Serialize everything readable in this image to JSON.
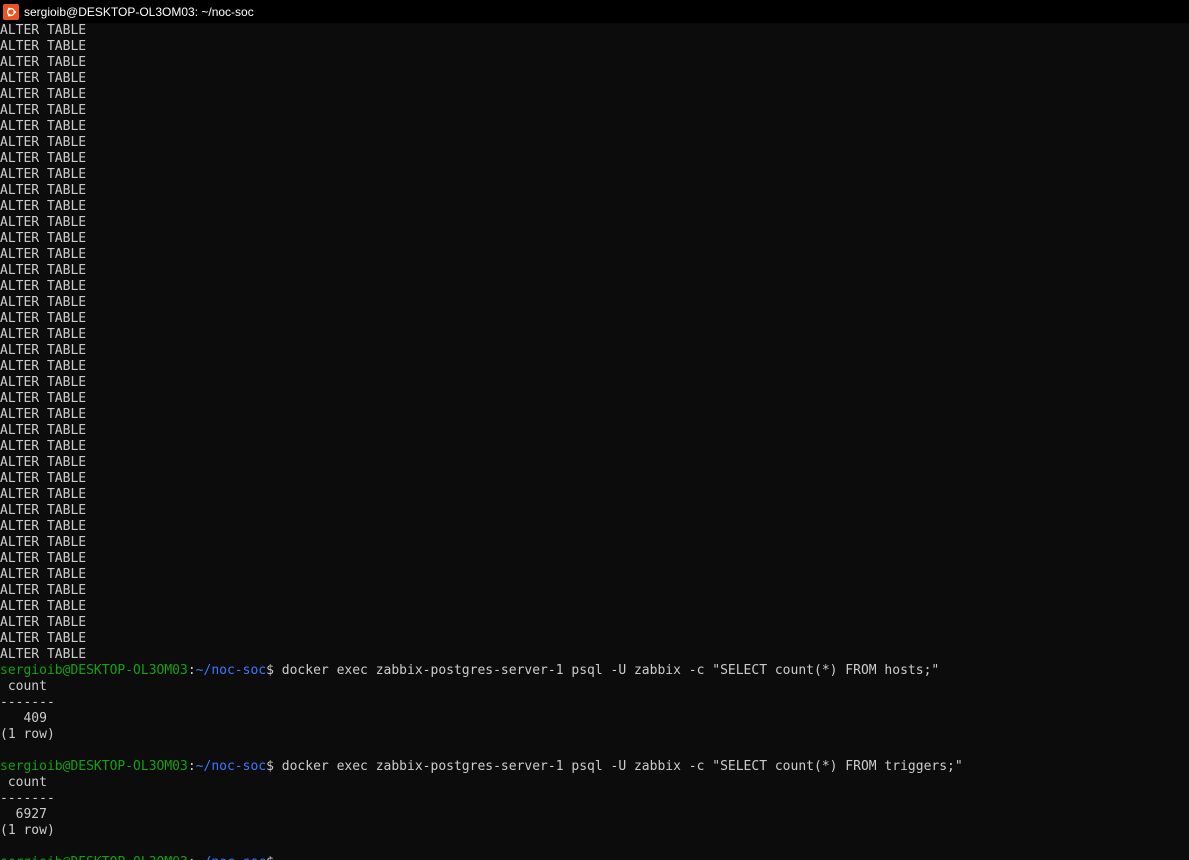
{
  "window": {
    "title": "sergioib@DESKTOP-OL3OM03: ~/noc-soc",
    "icon": "ubuntu-icon"
  },
  "colors": {
    "background": "#0c0c0c",
    "text": "#cccccc",
    "prompt_user": "#13a10e",
    "prompt_path": "#3b78ff",
    "icon_bg": "#e95420"
  },
  "prompt": {
    "user_host": "sergioib@DESKTOP-OL3OM03",
    "colon": ":",
    "path": "~/noc-soc",
    "dollar": "$"
  },
  "output_lines": [
    "ALTER TABLE",
    "ALTER TABLE",
    "ALTER TABLE",
    "ALTER TABLE",
    "ALTER TABLE",
    "ALTER TABLE",
    "ALTER TABLE",
    "ALTER TABLE",
    "ALTER TABLE",
    "ALTER TABLE",
    "ALTER TABLE",
    "ALTER TABLE",
    "ALTER TABLE",
    "ALTER TABLE",
    "ALTER TABLE",
    "ALTER TABLE",
    "ALTER TABLE",
    "ALTER TABLE",
    "ALTER TABLE",
    "ALTER TABLE",
    "ALTER TABLE",
    "ALTER TABLE",
    "ALTER TABLE",
    "ALTER TABLE",
    "ALTER TABLE",
    "ALTER TABLE",
    "ALTER TABLE",
    "ALTER TABLE",
    "ALTER TABLE",
    "ALTER TABLE",
    "ALTER TABLE",
    "ALTER TABLE",
    "ALTER TABLE",
    "ALTER TABLE",
    "ALTER TABLE",
    "ALTER TABLE",
    "ALTER TABLE",
    "ALTER TABLE",
    "ALTER TABLE",
    "ALTER TABLE"
  ],
  "commands": [
    {
      "command": " docker exec zabbix-postgres-server-1 psql -U zabbix -c \"SELECT count(*) FROM hosts;\"",
      "result": [
        " count ",
        "-------",
        "   409",
        "(1 row)",
        ""
      ]
    },
    {
      "command": " docker exec zabbix-postgres-server-1 psql -U zabbix -c \"SELECT count(*) FROM triggers;\"",
      "result": [
        " count ",
        "-------",
        "  6927",
        "(1 row)",
        ""
      ]
    }
  ],
  "final_prompt_command": ""
}
